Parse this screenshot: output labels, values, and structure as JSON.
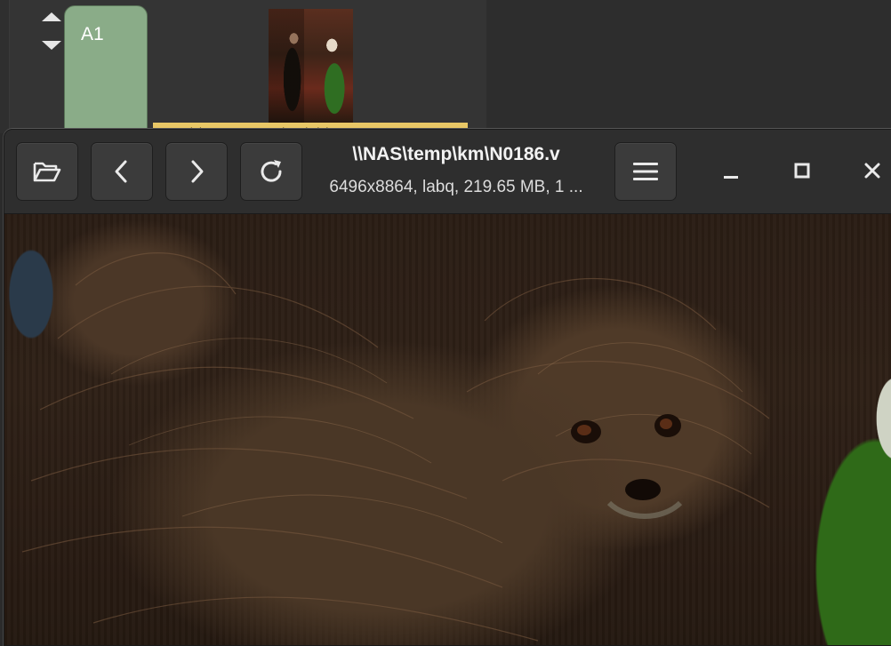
{
  "workspace": {
    "column_label": "A1",
    "thumbnail_caption": "N0186 labq, 6496x8864, bands labq..."
  },
  "viewer": {
    "title": "\\\\NAS\\temp\\km\\N0186.v",
    "subtitle": "6496x8864, labq, 219.65 MB, 1 ...",
    "buttons": {
      "open": "folder-open-icon",
      "prev": "chevron-left-icon",
      "next": "chevron-right-icon",
      "reload": "reload-icon",
      "menu": "hamburger-menu-icon",
      "minimize": "minimize-icon",
      "maximize": "maximize-icon",
      "close": "close-icon"
    },
    "image_description_icon": "painting-detail"
  },
  "colors": {
    "column_tab": "#8aac88",
    "caption_highlight": "#e8c766",
    "header_bg": "#2e2e2e",
    "button_bg": "#3b3b3b"
  }
}
